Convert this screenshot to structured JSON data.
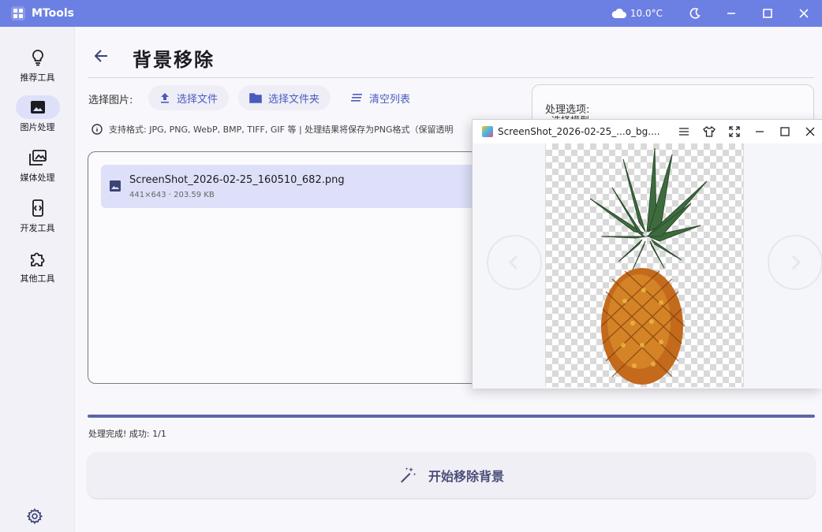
{
  "app": {
    "title": "MTools",
    "weather": "10.0°C",
    "brand_color": "#6c7fe3"
  },
  "sidebar": {
    "items": [
      {
        "label": "推荐工具",
        "icon": "lightbulb-icon"
      },
      {
        "label": "图片处理",
        "icon": "image-icon",
        "active": true
      },
      {
        "label": "媒体处理",
        "icon": "media-icon"
      },
      {
        "label": "开发工具",
        "icon": "code-icon"
      },
      {
        "label": "其他工具",
        "icon": "puzzle-icon"
      }
    ],
    "settings_icon": "gear-icon"
  },
  "page": {
    "title": "背景移除",
    "pick_label": "选择图片:",
    "btn_select_file": "选择文件",
    "btn_select_folder": "选择文件夹",
    "btn_clear": "清空列表",
    "info": "支持格式: JPG, PNG, WebP, BMP, TIFF, GIF 等 | 处理结果将保存为PNG格式（保留透明",
    "file": {
      "name": "ScreenShot_2026-02-25_160510_682.png",
      "meta": "441×643 · 203.59 KB"
    },
    "options_title": "处理选项:",
    "options_sub": "选择模型",
    "progress": 1.0,
    "status": "处理完成! 成功: 1/1",
    "start_button": "开始移除背景"
  },
  "viewer": {
    "title": "ScreenShot_2026-02-25_...o_bg....",
    "image": "pineapple"
  }
}
